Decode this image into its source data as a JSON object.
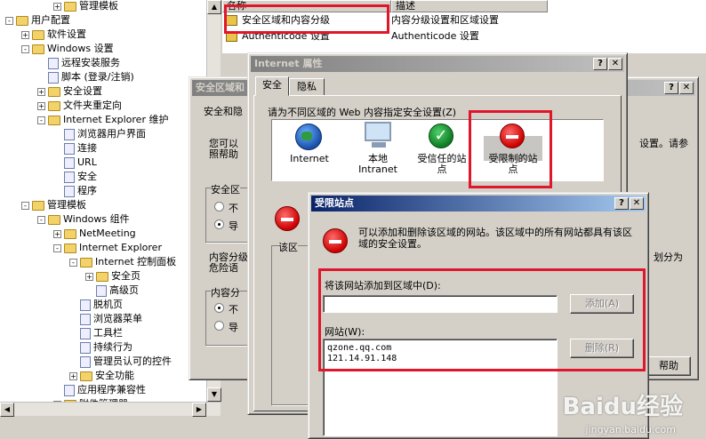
{
  "tree": {
    "items": [
      {
        "label": "管理模板",
        "level": 3,
        "expander": "+"
      },
      {
        "label": "用户配置",
        "level": 0,
        "expander": "-"
      },
      {
        "label": "软件设置",
        "level": 1,
        "expander": "+"
      },
      {
        "label": "Windows 设置",
        "level": 1,
        "expander": "-"
      },
      {
        "label": "远程安装服务",
        "level": 2,
        "expander": ""
      },
      {
        "label": "脚本 (登录/注销)",
        "level": 2,
        "expander": ""
      },
      {
        "label": "安全设置",
        "level": 2,
        "expander": "+"
      },
      {
        "label": "文件夹重定向",
        "level": 2,
        "expander": "+"
      },
      {
        "label": "Internet Explorer 维护",
        "level": 2,
        "expander": "-"
      },
      {
        "label": "浏览器用户界面",
        "level": 3,
        "expander": ""
      },
      {
        "label": "连接",
        "level": 3,
        "expander": ""
      },
      {
        "label": "URL",
        "level": 3,
        "expander": ""
      },
      {
        "label": "安全",
        "level": 3,
        "expander": ""
      },
      {
        "label": "程序",
        "level": 3,
        "expander": ""
      },
      {
        "label": "管理模板",
        "level": 1,
        "expander": "-"
      },
      {
        "label": "Windows 组件",
        "level": 2,
        "expander": "-"
      },
      {
        "label": "NetMeeting",
        "level": 3,
        "expander": "+"
      },
      {
        "label": "Internet Explorer",
        "level": 3,
        "expander": "-"
      },
      {
        "label": "Internet 控制面板",
        "level": 4,
        "expander": "-"
      },
      {
        "label": "安全页",
        "level": 5,
        "expander": "+"
      },
      {
        "label": "高级页",
        "level": 5,
        "expander": ""
      },
      {
        "label": "脱机页",
        "level": 4,
        "expander": ""
      },
      {
        "label": "浏览器菜单",
        "level": 4,
        "expander": ""
      },
      {
        "label": "工具栏",
        "level": 4,
        "expander": ""
      },
      {
        "label": "持续行为",
        "level": 4,
        "expander": ""
      },
      {
        "label": "管理员认可的控件",
        "level": 4,
        "expander": ""
      },
      {
        "label": "安全功能",
        "level": 4,
        "expander": "+"
      },
      {
        "label": "应用程序兼容性",
        "level": 3,
        "expander": ""
      },
      {
        "label": "附件管理器",
        "level": 3,
        "expander": "+"
      }
    ]
  },
  "list": {
    "col_name": "名称",
    "col_desc": "描述",
    "rows": [
      {
        "name": "安全区域和内容分级",
        "desc": "内容分级设置和区域设置"
      },
      {
        "name": "Authenticode 设置",
        "desc": "Authenticode 设置"
      }
    ]
  },
  "security_zone_window": {
    "title": "安全区域和",
    "intro_lines": [
      "安全和隐",
      "您可以",
      "照帮助"
    ],
    "right_text": "设置。请参",
    "group1_label": "安全区",
    "radio1": "不",
    "radio2": "导",
    "content_lines": [
      "内容分级",
      "危险语"
    ],
    "group2_label": "内容分",
    "radio3": "不",
    "radio4": "导",
    "zone_partial": "该区域",
    "right_partial": "划分为",
    "help_button": "帮助"
  },
  "internet_props": {
    "title": "Internet 属性",
    "tabs": [
      "安全",
      "隐私"
    ],
    "prompt": "请为不同区域的 Web 内容指定安全设置(Z)",
    "zones": [
      {
        "label": "Internet",
        "icon": "globe-icon"
      },
      {
        "label": "本地\nIntranet",
        "icon": "computer-icon"
      },
      {
        "label": "受信任的站\n点",
        "icon": "checkmark-icon"
      },
      {
        "label": "受限制的站\n点",
        "icon": "stop-icon"
      }
    ],
    "partial_left": "该区"
  },
  "restricted_dialog": {
    "title": "受限站点",
    "description": "可以添加和删除该区域的网站。该区域中的所有网站都具有该区域的安全设置。",
    "add_label": "将该网站添加到区域中(D):",
    "add_input_value": "",
    "add_button": "添加(A)",
    "sites_label": "网站(W):",
    "sites": [
      "qzone.qq.com",
      "121.14.91.148"
    ],
    "remove_button": "删除(R)"
  },
  "watermark": {
    "brand": "Baidu经验",
    "url": "jingyan.baidu.com"
  },
  "colors": {
    "highlight_red": "#e0162b",
    "title_active": "#0a246a",
    "window_face": "#d4d0c8"
  }
}
